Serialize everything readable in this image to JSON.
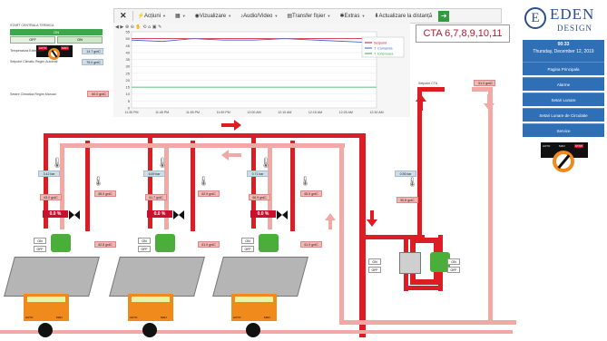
{
  "toolbar": {
    "actions_label": "Acțiuni",
    "view_label": "Vizualizare",
    "audio_video_label": "Audio/Video",
    "file_transfer_label": "Transfer fișier",
    "extras_label": "Extras",
    "update_label": "Actualizare la distanță"
  },
  "left_panel": {
    "window_title": "START CENTRALA TERMICA",
    "status_on": "ON",
    "off_button": "OFF",
    "on_button": "ON",
    "auto_label": "AUTO",
    "man_label": "MAN",
    "rows": [
      {
        "label": "Temperatura Exterioara",
        "value": "14.7 grdC"
      },
      {
        "label": "Setpoint Climatic Regim Automat",
        "value": "75.0 grdC"
      }
    ],
    "manual_label": "Setare Climatica Regim Manual",
    "manual_value": "60.0 grdC"
  },
  "chart_data": {
    "type": "line",
    "y_ticks": [
      "55",
      "50",
      "45",
      "40",
      "35",
      "30",
      "25",
      "20",
      "15",
      "10",
      "5",
      "0"
    ],
    "x_ticks": [
      "11:35 PM",
      "11:45 PM",
      "11:55 PM",
      "11:59 PM",
      "12:00 AM",
      "12:10 AM",
      "12:15 AM",
      "12:25 AM",
      "12:30 AM"
    ],
    "ylim": [
      0,
      55
    ],
    "series": [
      {
        "name": "Setpoint",
        "color": "#c8102e",
        "values": [
          50,
          50,
          50,
          50,
          50,
          50,
          50,
          50,
          50
        ]
      },
      {
        "name": "T. Comanda",
        "color": "#3a5fcd",
        "values": [
          49,
          48,
          50,
          49,
          49,
          50,
          49,
          48,
          47
        ]
      },
      {
        "name": "T. Exterioara",
        "color": "#3aa84a",
        "values": [
          15,
          15,
          15,
          15,
          15,
          15,
          15,
          15,
          15
        ]
      }
    ]
  },
  "cta_title": "CTA 6,7,8,9,10,11",
  "cta_setpoint": {
    "label": "Setpoint CTA",
    "value": "51.0 grdC"
  },
  "sidebar": {
    "logo_top": "EDEN",
    "logo_bottom": "DESIGN",
    "time": "00:33",
    "date": "Thursday, December 12, 2019",
    "nav": [
      "Pagina Principala",
      "Alarme",
      "Setari Lunare",
      "Setari Lunare de Circulatie",
      "Service"
    ],
    "auto_label": "AUTO",
    "man_label": "MAN",
    "stop_label": "STOP"
  },
  "boilers": [
    {
      "pressure": "3.42 bar",
      "temp_in": "63.0 grdC",
      "temp_out": "68.0 grdC",
      "valve": "0.0 %",
      "temp_ret": "62.8 grdC",
      "on": "ON",
      "off": "OFF"
    },
    {
      "pressure": "6.69 bar",
      "temp_in": "61.7 grdC",
      "temp_out": "62.9 grdC",
      "valve": "0.0 %",
      "temp_ret": "61.9 grdC",
      "on": "ON",
      "off": "OFF"
    },
    {
      "pressure": "0.71 bar",
      "temp_in": "66.9 grdC",
      "temp_out": "65.5 grdC",
      "valve": "0.0 %",
      "temp_ret": "61.9 grdC",
      "on": "ON",
      "off": "OFF"
    }
  ],
  "cta_unit": {
    "pressure": "0.56 bar",
    "temp": "50.8 grdC",
    "on": "ON",
    "off": "OFF",
    "on2": "ON",
    "off2": "OFF"
  },
  "boiler_panel": {
    "auto": "AUTO",
    "man": "MAN",
    "stop": "STOP"
  }
}
